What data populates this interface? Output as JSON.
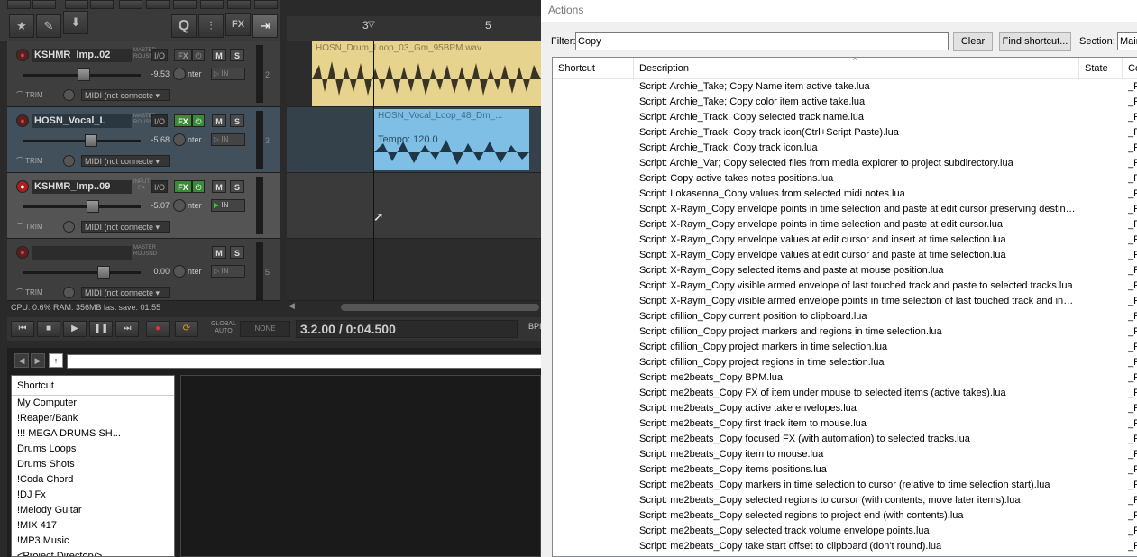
{
  "toolbar": {
    "buttons": [
      "★",
      "✎",
      "⬇",
      "Q",
      "⫶",
      "FX",
      "⇥"
    ]
  },
  "tracks": [
    {
      "name": "KSHMR_Imp..02",
      "route": "MASTER ROUSND",
      "io": "I/O",
      "fx": "FX",
      "m": "M",
      "s": "S",
      "vol": "-9.53",
      "pan": "nter",
      "input": "IN",
      "trim": "TRIM",
      "midi": "MIDI (not connecte",
      "num": "2"
    },
    {
      "name": "HOSN_Vocal_L",
      "route": "MASTER ROUSND",
      "io": "I/O",
      "fx": "FX",
      "m": "M",
      "s": "S",
      "vol": "-5.68",
      "pan": "nter",
      "input": "IN",
      "trim": "TRIM",
      "midi": "MIDI (not connecte",
      "num": "3"
    },
    {
      "name": "KSHMR_Imp..09",
      "route": "INPUT FX",
      "io": "I/O",
      "fx": "FX",
      "m": "M",
      "s": "S",
      "vol": "-5.07",
      "pan": "nter",
      "input": "IN",
      "trim": "TRIM",
      "midi": "MIDI (not connecte",
      "num": ""
    },
    {
      "name": "",
      "route": "MASTER ROUSND",
      "io": "I/O",
      "fx": "",
      "m": "M",
      "s": "S",
      "vol": "0.00",
      "pan": "nter",
      "input": "IN",
      "trim": "TRIM",
      "midi": "MIDI (not connecte",
      "num": "5"
    }
  ],
  "status": "CPU: 0.6%   RAM: 356MB   last save: 01:55",
  "ruler": {
    "mark1": "3",
    "mark2": "5"
  },
  "items": {
    "item1_name": "HOSN_Drum_Loop_03_Gm_95BPM.wav",
    "item2_name": "HOSN_Vocal_Loop_48_Dm_...",
    "item2_tempo": "Tempo: 120.0"
  },
  "transport": {
    "buttons": [
      "⏮",
      "■",
      "▶",
      "❚❚",
      "⏭"
    ],
    "rec": "●",
    "loop": "⟳",
    "global_auto": "GLOBAL AUTO",
    "auto_none": "NONE",
    "time": "3.2.00 / 0:04.500",
    "bpm": "BPI"
  },
  "explorer": {
    "back": "◀",
    "fwd": "▶",
    "up": "↑",
    "header": "Shortcut",
    "items": [
      "My Computer",
      "!Reaper/Bank",
      "!!! MEGA DRUMS SH...",
      "Drums Loops",
      "Drums Shots",
      "!Coda Chord",
      "!DJ Fx",
      "!Melody Guitar",
      "!MIX 417",
      "!MP3 Music",
      "<Project Directory>"
    ]
  },
  "actions": {
    "title": "Actions",
    "filter_label": "Filter:",
    "filter_value": "Copy",
    "clear": "Clear",
    "find_shortcut": "Find shortcut...",
    "section_label": "Section:",
    "section_value": "Main",
    "columns": [
      "Shortcut",
      "Description",
      "State",
      "Co"
    ],
    "sort_indicator": "^",
    "rows": [
      "Script: Archie_Take;  Copy Name item active take.lua",
      "Script: Archie_Take;  Copy color item active take.lua",
      "Script: Archie_Track;  Copy selected track name.lua",
      "Script: Archie_Track;  Copy track icon(Ctrl+Script Paste).lua",
      "Script: Archie_Track;  Copy track icon.lua",
      "Script: Archie_Var;  Copy selected files from media explorer to project subdirectory.lua",
      "Script: Copy active takes notes positions.lua",
      "Script: Lokasenna_Copy values from selected midi notes.lua",
      "Script: X-Raym_Copy envelope points in time selection and paste at edit cursor preserving destinatio...",
      "Script: X-Raym_Copy envelope points in time selection and paste at edit cursor.lua",
      "Script: X-Raym_Copy envelope values at edit cursor and insert at time selection.lua",
      "Script: X-Raym_Copy envelope values at edit cursor and paste at time selection.lua",
      "Script: X-Raym_Copy selected items and paste at mouse position.lua",
      "Script: X-Raym_Copy visible armed envelope of last touched track and paste to selected tracks.lua",
      "Script: X-Raym_Copy visible armed envelope points in time selection of last touched track and insert ...",
      "Script: cfillion_Copy current position to clipboard.lua",
      "Script: cfillion_Copy project markers and regions in time selection.lua",
      "Script: cfillion_Copy project markers in time selection.lua",
      "Script: cfillion_Copy project regions in time selection.lua",
      "Script: me2beats_Copy BPM.lua",
      "Script: me2beats_Copy FX of item under mouse to selected items (active takes).lua",
      "Script: me2beats_Copy active take envelopes.lua",
      "Script: me2beats_Copy first track item to mouse.lua",
      "Script: me2beats_Copy focused FX (with automation) to selected tracks.lua",
      "Script: me2beats_Copy item to mouse.lua",
      "Script: me2beats_Copy items positions.lua",
      "Script: me2beats_Copy markers in time selection to cursor (relative to time selection start).lua",
      "Script: me2beats_Copy selected regions to cursor (with contents, move later items).lua",
      "Script: me2beats_Copy selected regions to project end (with contents).lua",
      "Script: me2beats_Copy selected track volume envelope points.lua",
      "Script: me2beats_Copy take start offset to clipboard (don't round).lua"
    ],
    "row_c": "_F"
  }
}
